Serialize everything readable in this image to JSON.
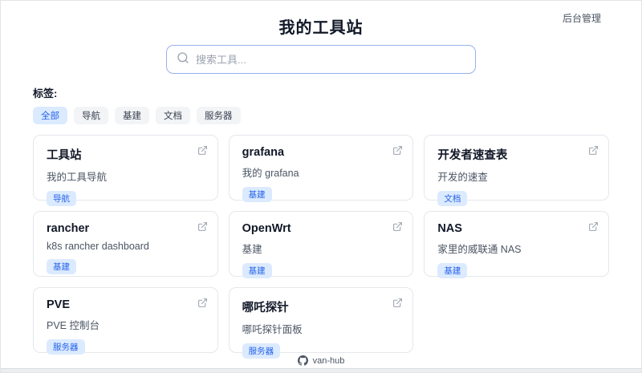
{
  "header": {
    "title": "我的工具站",
    "admin_link": "后台管理"
  },
  "search": {
    "placeholder": "搜索工具...",
    "value": "",
    "icon": "search-icon"
  },
  "tags": {
    "label": "标签:",
    "items": [
      {
        "label": "全部",
        "active": true
      },
      {
        "label": "导航",
        "active": false
      },
      {
        "label": "基建",
        "active": false
      },
      {
        "label": "文档",
        "active": false
      },
      {
        "label": "服务器",
        "active": false
      }
    ]
  },
  "cards": [
    {
      "title": "工具站",
      "description": "我的工具导航",
      "tag": "导航",
      "icon": "external-link-icon"
    },
    {
      "title": "grafana",
      "description": "我的 grafana",
      "tag": "基建",
      "icon": "external-link-icon"
    },
    {
      "title": "开发者速查表",
      "description": "开发的速查",
      "tag": "文档",
      "icon": "external-link-icon"
    },
    {
      "title": "rancher",
      "description": "k8s rancher dashboard",
      "tag": "基建",
      "icon": "external-link-icon"
    },
    {
      "title": "OpenWrt",
      "description": "基建",
      "tag": "基建",
      "icon": "external-link-icon"
    },
    {
      "title": "NAS",
      "description": "家里的威联通 NAS",
      "tag": "基建",
      "icon": "external-link-icon"
    },
    {
      "title": "PVE",
      "description": "PVE 控制台",
      "tag": "服务器",
      "icon": "external-link-icon"
    },
    {
      "title": "哪吒探针",
      "description": "哪吒探针面板",
      "tag": "服务器",
      "icon": "external-link-icon"
    }
  ],
  "footer": {
    "brand": "van-hub",
    "icon": "github-icon"
  },
  "colors": {
    "accent_blue": "#2563eb",
    "tag_bg": "#dbeafe",
    "search_border": "#97b1ee",
    "card_border": "#e5e7eb",
    "muted_text": "#4b5563"
  }
}
